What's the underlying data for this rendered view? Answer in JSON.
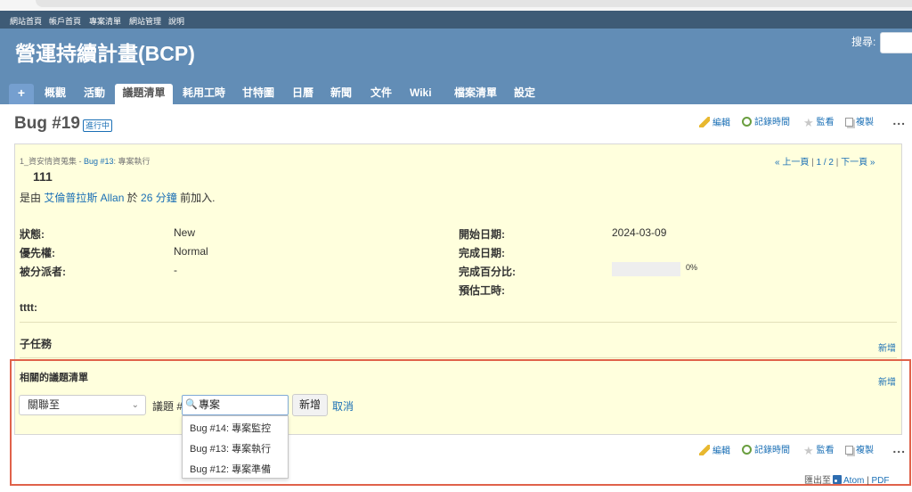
{
  "top_menu": [
    "網站首頁",
    "帳戶首頁",
    "專案清單",
    "網站管理",
    "說明"
  ],
  "header": {
    "project_title": "營運持續計畫(BCP)",
    "search_label": "搜尋:"
  },
  "tabs": [
    "+",
    "概觀",
    "活動",
    "議題清單",
    "耗用工時",
    "甘特圖",
    "日曆",
    "新聞",
    "文件",
    "Wiki",
    "檔案清單",
    "設定"
  ],
  "issue": {
    "title": "Bug #19",
    "status_badge": "進行中",
    "parent_path": "1_資安情資蒐集 - ",
    "parent_link": "Bug #13",
    "parent_subject": ": 專案執行",
    "subject": "111",
    "author_prefix": "是由 ",
    "author": "艾倫普拉斯 Allan",
    "author_mid": " 於 ",
    "time_ago": "26 分鐘",
    "author_suffix": " 前加入.",
    "nav": {
      "prev": "« 上一頁",
      "sep1": " | ",
      "position": "1 / 2",
      "sep2": " | ",
      "next": "下一頁 »"
    },
    "attributes_left": [
      {
        "label": "狀態:",
        "value": "New"
      },
      {
        "label": "優先權:",
        "value": "Normal"
      },
      {
        "label": "被分派者:",
        "value": "-"
      }
    ],
    "attributes_right": [
      {
        "label": "開始日期:",
        "value": "2024-03-09"
      },
      {
        "label": "完成日期:",
        "value": ""
      },
      {
        "label": "完成百分比:",
        "value": "0%"
      },
      {
        "label": "預估工時:",
        "value": ""
      }
    ],
    "progress": 0,
    "custom_field_label": "tttt:",
    "subtasks_title": "子任務",
    "subtasks_add": "新增",
    "relations_title": "相關的議題清單",
    "relations_add": "新增"
  },
  "actions": {
    "edit": "編輯",
    "log_time": "記錄時間",
    "watch": "監看",
    "copy": "複製",
    "more": "..."
  },
  "relation_form": {
    "type_selected": "關聯至",
    "issue_label": "議題 #",
    "input_value": "專案",
    "add_button": "新增",
    "cancel": "取消",
    "suggestions": [
      "Bug #14: 專案監控",
      "Bug #13: 專案執行",
      "Bug #12: 專案準備"
    ]
  },
  "export": {
    "label": "匯出至",
    "atom": "Atom",
    "sep": " | ",
    "pdf": "PDF"
  },
  "colors": {
    "top_menu": "#3e5b76",
    "header": "#628db6",
    "issue_bg": "#ffffdd",
    "highlight": "#e0624a",
    "link": "#1a6fb5"
  }
}
